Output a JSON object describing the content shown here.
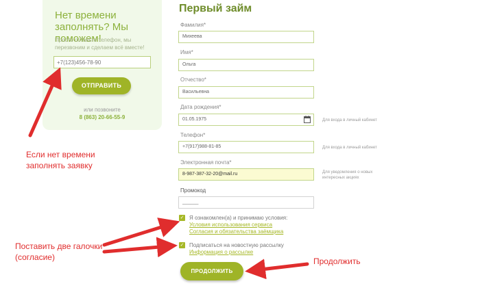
{
  "callback": {
    "title": "Нет времени заполнять? Мы поможем!",
    "text": "Просто оставьте телефон, мы перезвоним и сделаем всё вместе!",
    "phone_value": "+7(123)456-78-90",
    "send_label": "ОТПРАВИТЬ",
    "or_call": "или позвоните",
    "phone_number": "8 (863) 20-66-55-9"
  },
  "form": {
    "title": "Первый займ",
    "fields": {
      "surname": {
        "label": "Фамилия*",
        "value": "Михеева"
      },
      "name": {
        "label": "Имя*",
        "value": "Ольга"
      },
      "patronymic": {
        "label": "Отчество*",
        "value": "Васильевна"
      },
      "birthdate": {
        "label": "Дата рождения*",
        "value": "01.05.1975",
        "hint": "Для входа в личный кабинет"
      },
      "phone": {
        "label": "Телефон*",
        "value": "+7(917)988-81-85",
        "hint": "Для входа в личный кабинет"
      },
      "email": {
        "label": "Электронная почта*",
        "value": "8-987-387-32-20@mail.ru",
        "hint": "Для уведомления о новых интересных акциях"
      },
      "promo": {
        "label": "Промокод",
        "value": "______"
      }
    },
    "terms": {
      "text": "Я ознакомлен(а) и принимаю условия:",
      "link1": "Условия использования сервиса",
      "link2": "Согласия и обязательства заёмщика"
    },
    "newsletter": {
      "text": "Подписаться на новостную рассылку",
      "link": "Информация о рассылке"
    },
    "continue_label": "ПРОДОЛЖИТЬ"
  },
  "annotations": {
    "left_top": "Если нет времени заполнять заявку",
    "left_bottom": "Поставить две галочки (согласие)",
    "right": "Продолжить"
  },
  "colors": {
    "accent": "#9fb427",
    "annotation": "#e02d2d",
    "panel": "#f1f9e9"
  }
}
